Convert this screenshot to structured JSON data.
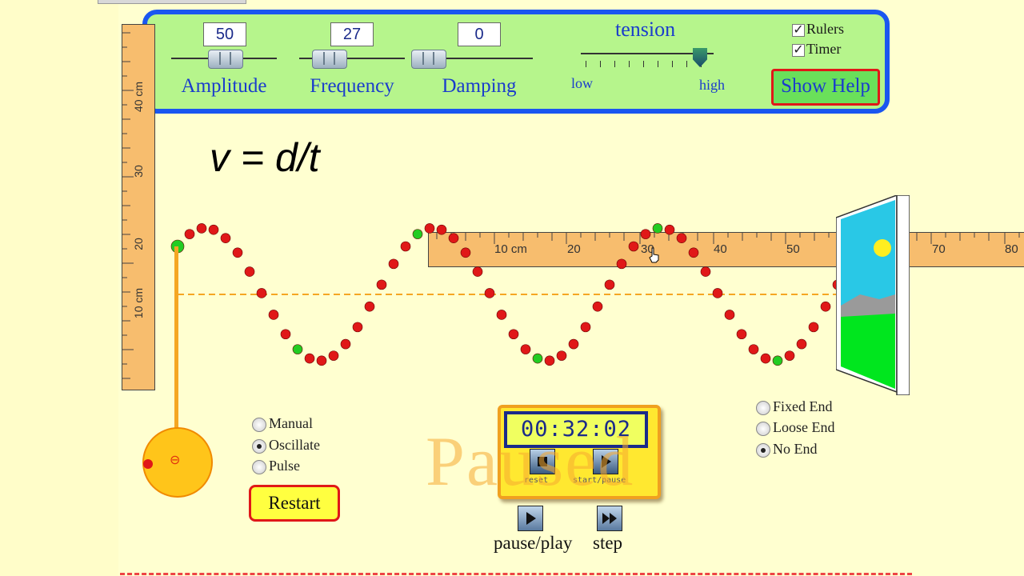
{
  "controls": {
    "amplitude": {
      "value": "50",
      "label": "Amplitude"
    },
    "frequency": {
      "value": "27",
      "label": "Frequency"
    },
    "damping": {
      "value": "0",
      "label": "Damping"
    },
    "tension": {
      "label": "tension",
      "low": "low",
      "high": "high",
      "level": 0.9
    },
    "rulers": {
      "label": "Rulers",
      "checked": true
    },
    "timer_toggle": {
      "label": "Timer",
      "checked": true
    },
    "help_label": "Show Help"
  },
  "formula": "v = d/t",
  "vertical_ruler": {
    "labels": [
      "40 cm",
      "30",
      "20",
      "10 cm"
    ]
  },
  "horizontal_ruler": {
    "labels": [
      "10 cm",
      "20",
      "30",
      "40",
      "50",
      "70",
      "80"
    ]
  },
  "mode": {
    "options": [
      "Manual",
      "Oscillate",
      "Pulse"
    ],
    "selected": "Oscillate"
  },
  "restart_label": "Restart",
  "end_type": {
    "options": [
      "Fixed End",
      "Loose End",
      "No End"
    ],
    "selected": "No End"
  },
  "timer": {
    "display": "00:32:02",
    "reset_label": "reset",
    "start_pause_label": "start/pause"
  },
  "status_overlay": "Paused",
  "playback": {
    "pause_play_label": "pause/play",
    "step_label": "step"
  },
  "colors": {
    "background": "#ffffd0",
    "panel": "#b6f58c",
    "panel_border": "#1a56f0",
    "bead_red": "#e01818",
    "bead_green": "#22cc22",
    "ruler": "#f7bd6e"
  }
}
